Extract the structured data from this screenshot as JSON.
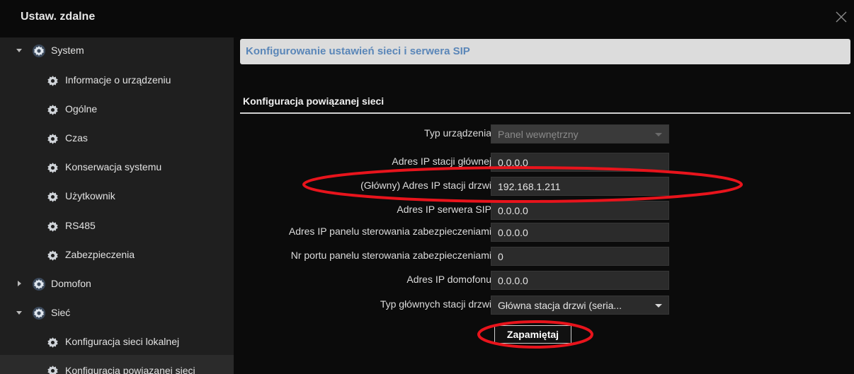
{
  "window": {
    "title": "Ustaw. zdalne"
  },
  "sidebar": {
    "items": [
      {
        "label": "System",
        "level": 0,
        "expanded": true
      },
      {
        "label": "Informacje o urządzeniu",
        "level": 1
      },
      {
        "label": "Ogólne",
        "level": 1
      },
      {
        "label": "Czas",
        "level": 1
      },
      {
        "label": "Konserwacja systemu",
        "level": 1
      },
      {
        "label": "Użytkownik",
        "level": 1
      },
      {
        "label": "RS485",
        "level": 1
      },
      {
        "label": "Zabezpieczenia",
        "level": 1
      },
      {
        "label": "Domofon",
        "level": 0,
        "expanded": false
      },
      {
        "label": "Sieć",
        "level": 0,
        "expanded": true
      },
      {
        "label": "Konfiguracja sieci lokalnej",
        "level": 1
      },
      {
        "label": "Konfiguracja powiązanej sieci",
        "level": 1,
        "selected": true
      }
    ]
  },
  "main": {
    "header": "Konfigurowanie ustawień sieci i serwera SIP",
    "section_title": "Konfiguracja powiązanej sieci",
    "fields": [
      {
        "label": "Typ urządzenia",
        "value": "Panel wewnętrzny",
        "type": "select",
        "disabled": true
      },
      {
        "label": "Adres IP stacji głównej",
        "value": "0.0.0.0",
        "type": "text"
      },
      {
        "label": "(Główny) Adres IP stacji drzwi",
        "value": "192.168.1.211",
        "type": "text"
      },
      {
        "label": "Adres IP serwera SIP",
        "value": "0.0.0.0",
        "type": "text"
      },
      {
        "label": "Adres IP panelu sterowania zabezpieczeniami",
        "value": "0.0.0.0",
        "type": "text"
      },
      {
        "label": "Nr portu panelu sterowania zabezpieczeniami",
        "value": "0",
        "type": "text"
      },
      {
        "label": "Adres IP domofonu",
        "value": "0.0.0.0",
        "type": "text"
      },
      {
        "label": "Typ głównych stacji drzwi",
        "value": "Główna stacja drzwi (seria...",
        "type": "select"
      }
    ],
    "save_label": "Zapamiętaj"
  },
  "colors": {
    "background": "#0b0b0b",
    "sidebar": "#1f1f1f",
    "header_bar": "#dcdcdc",
    "header_text": "#5a86b8",
    "annotation": "#e8141c"
  },
  "icons": {
    "gear": "gear-icon",
    "close": "close-icon",
    "expand": "chevron-down-icon",
    "collapse": "chevron-right-icon"
  }
}
